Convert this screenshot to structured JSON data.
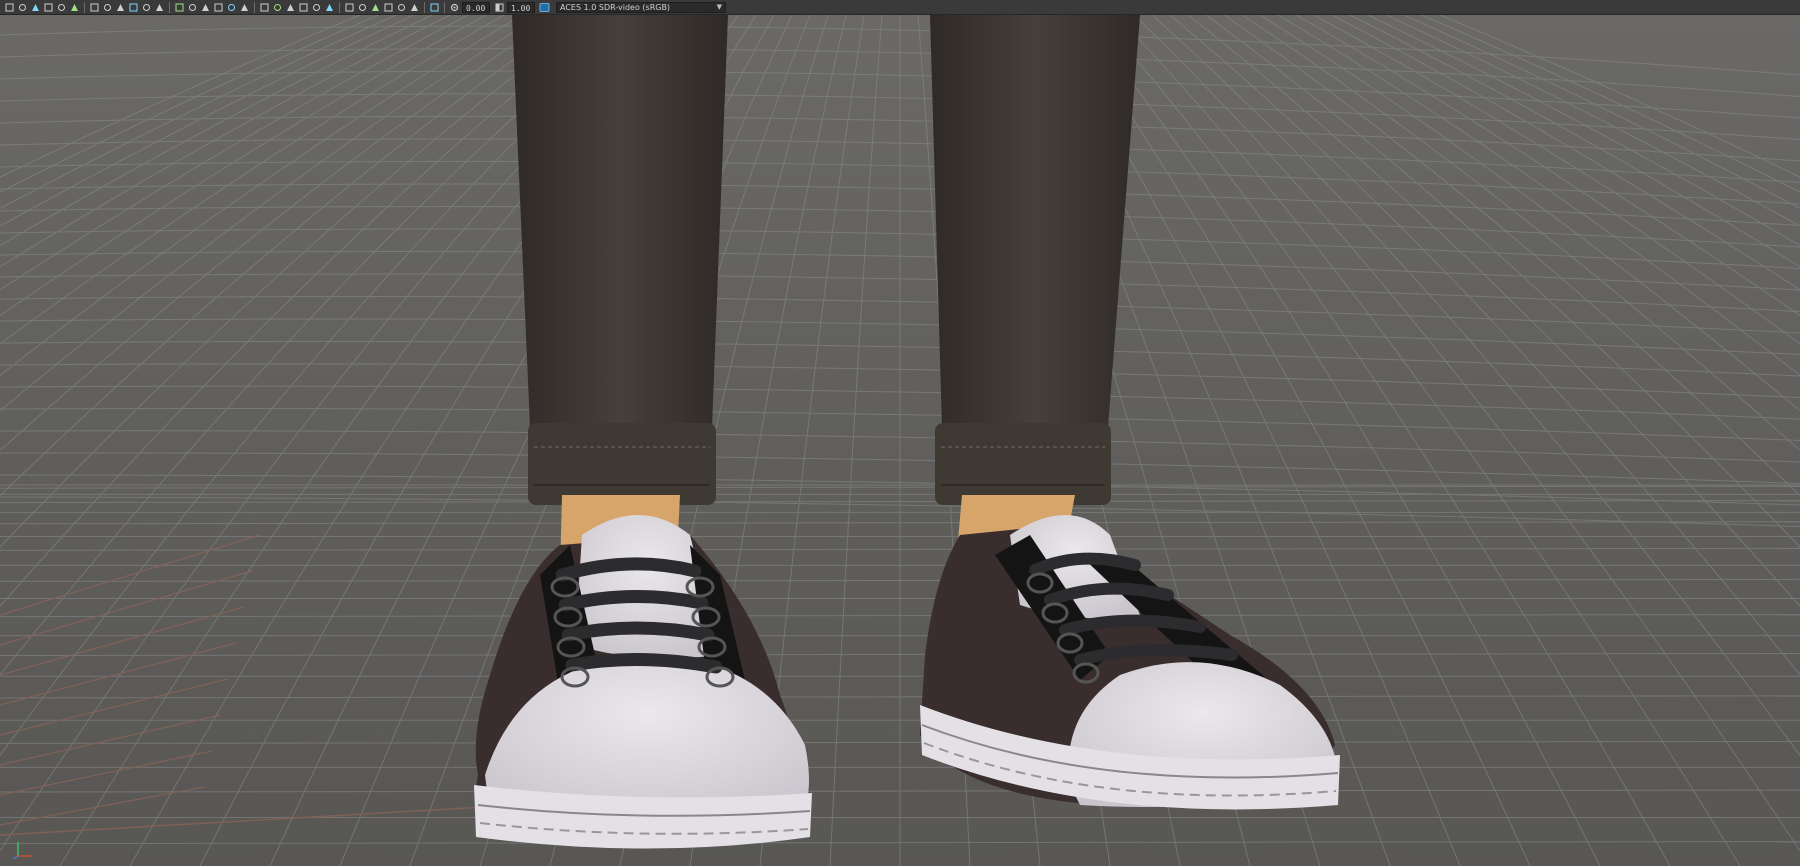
{
  "toolbar": {
    "exposure_value": "0.00",
    "gamma_value": "1.00",
    "color_space": "ACES 1.0 SDR-video (sRGB)",
    "icons": [
      "render-icon",
      "camera-icon",
      "film-icon",
      "lock-icon",
      "pin-icon",
      "measure-icon",
      "grid-icon",
      "wireframe-icon",
      "safe-frame-icon",
      "region-icon",
      "crop-icon",
      "compare-icon",
      "layers-icon",
      "text-icon",
      "cube-icon",
      "shade-icon",
      "light-icon",
      "smooth-icon",
      "bbox-icon",
      "texture-icon",
      "material-icon",
      "env-icon",
      "color-icon",
      "brush-icon",
      "select-icon",
      "arrow-icon",
      "move-icon",
      "copy-icon",
      "paste-icon",
      "snapshot-icon",
      "gear-icon",
      "exposure-icon",
      "gamma-icon",
      "display-icon"
    ]
  },
  "colors": {
    "background": "#5f5e5b",
    "toolbar": "#3a3a3a",
    "grid": "#8a8a8c",
    "grid_red": "#a0685a",
    "pants": "#3e3834",
    "shoe_white": "#dedbe0",
    "shoe_brown": "#3a2d2e",
    "laces": "#2c2c2e",
    "skin": "#d7a56a"
  },
  "viewport": {
    "axis_labels": {
      "x": "x",
      "y": "y",
      "z": "z"
    }
  }
}
